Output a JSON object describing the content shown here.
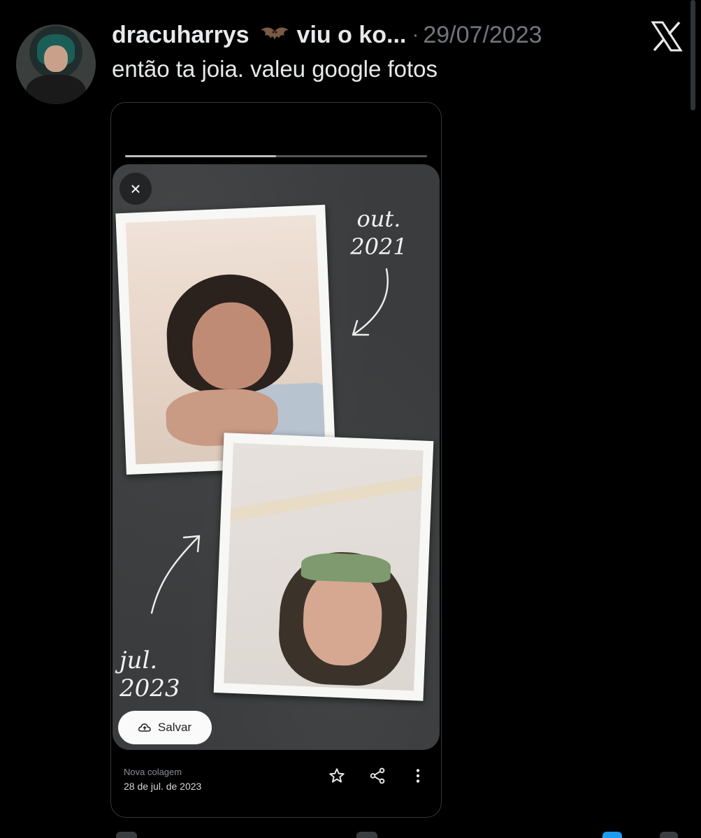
{
  "tweet": {
    "display_name": "dracuharrys",
    "emoji_icon": "bat-emoji",
    "truncated_name": "viu o ko...",
    "separator": "·",
    "date": "29/07/2023",
    "text": "então ta joia. valeu google fotos",
    "platform_logo": "x-logo"
  },
  "embedded_screenshot": {
    "progress_percent": 50,
    "close_icon": "×",
    "photo_1_label_month": "out.",
    "photo_1_label_year": "2021",
    "photo_2_label_month": "jul.",
    "photo_2_label_year": "2023",
    "save_button_label": "Salvar",
    "footer_title": "Nova colagem",
    "footer_date": "28 de jul. de 2023",
    "footer_icons": [
      "star-icon",
      "share-icon",
      "more-vert-icon"
    ]
  },
  "colors": {
    "background": "#000000",
    "text_primary": "#e7e9ea",
    "text_secondary": "#71767b",
    "collage_bg": "#3a3c3d"
  }
}
